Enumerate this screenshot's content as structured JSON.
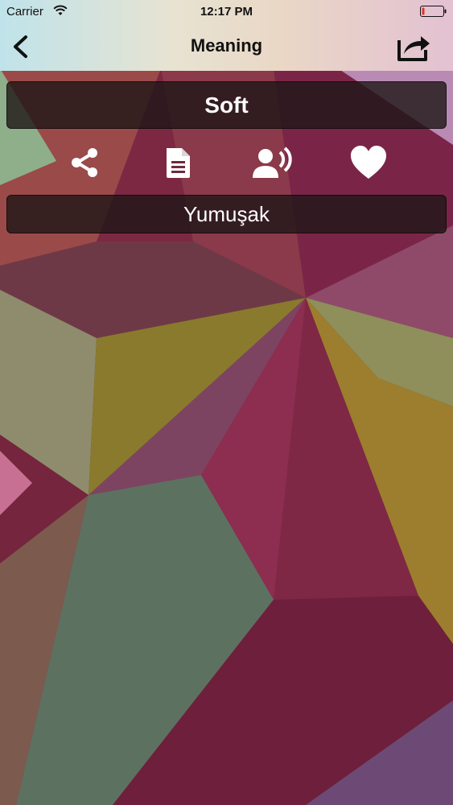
{
  "status_bar": {
    "carrier": "Carrier",
    "time": "12:17 PM",
    "battery_color": "#e0322a"
  },
  "nav": {
    "title": "Meaning",
    "back_icon": "chevron-left-icon",
    "share_icon": "share-out-icon"
  },
  "word": {
    "term": "Soft",
    "meaning": "Yumuşak"
  },
  "actions": [
    {
      "name": "share",
      "icon": "share-nodes-icon"
    },
    {
      "name": "copy",
      "icon": "document-icon"
    },
    {
      "name": "speak",
      "icon": "speaker-person-icon"
    },
    {
      "name": "favorite",
      "icon": "heart-icon"
    }
  ],
  "colors": {
    "text_dark": "#111111",
    "card_bg": "rgba(30,22,22,0.80)",
    "icon_white": "#ffffff"
  }
}
